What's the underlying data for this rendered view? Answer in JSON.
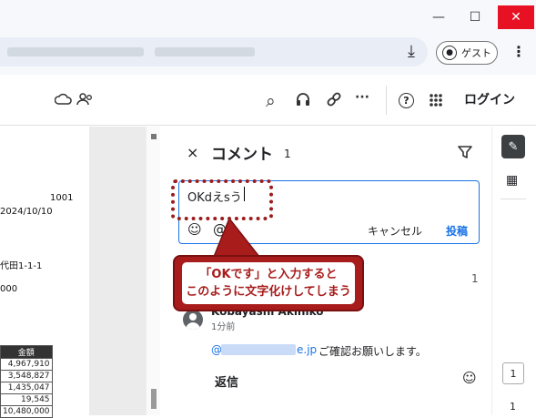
{
  "window": {
    "min_glyph": "—",
    "max_glyph": "☐",
    "close_glyph": "✕"
  },
  "browser": {
    "download_glyph": "⤓",
    "guest_label": "ゲスト",
    "menu_glyph": "⋮"
  },
  "toolbar": {
    "search_glyph": "⌕",
    "headset_glyph": "🎧",
    "link_glyph": "🔗",
    "more_glyph": "···",
    "help_glyph": "?",
    "apps_glyph": "⁝⁝⁝",
    "login_label": "ログイン"
  },
  "document": {
    "lines": [
      {
        "text": "1001"
      },
      {
        "text": "2024/10/10"
      },
      {
        "text": "代田1-1-1"
      },
      {
        "text": "000"
      }
    ],
    "table_header": "金額",
    "table_values": [
      "4,967,910",
      "3,548,827",
      "1,435,047",
      "19,545",
      "10,480,000"
    ]
  },
  "comments": {
    "close_glyph": "×",
    "title": "コメント",
    "count": "1",
    "filter_glyph": "▽",
    "input_value": "OKdえsう",
    "emoji_glyph": "☺",
    "mention_glyph": "@",
    "cancel_label": "キャンセル",
    "post_label": "投稿",
    "thread_count": "1",
    "author": "Kobayashi Akihiko",
    "time_ago": "1分前",
    "mention_prefix": "@",
    "mention_suffix": "e.jp",
    "message": "ご確認お願いします。",
    "reply_label": "返信",
    "react_glyph": "☺"
  },
  "callout": {
    "line1": "「OKです」と入力すると",
    "line2": "このように文字化けしてしまう"
  },
  "rail": {
    "comment_glyph": "✎",
    "grid_glyph": "▦",
    "page_current": "1",
    "page_next": "1"
  },
  "colors": {
    "accent": "#1a73e8",
    "callout": "#a81c1c"
  }
}
